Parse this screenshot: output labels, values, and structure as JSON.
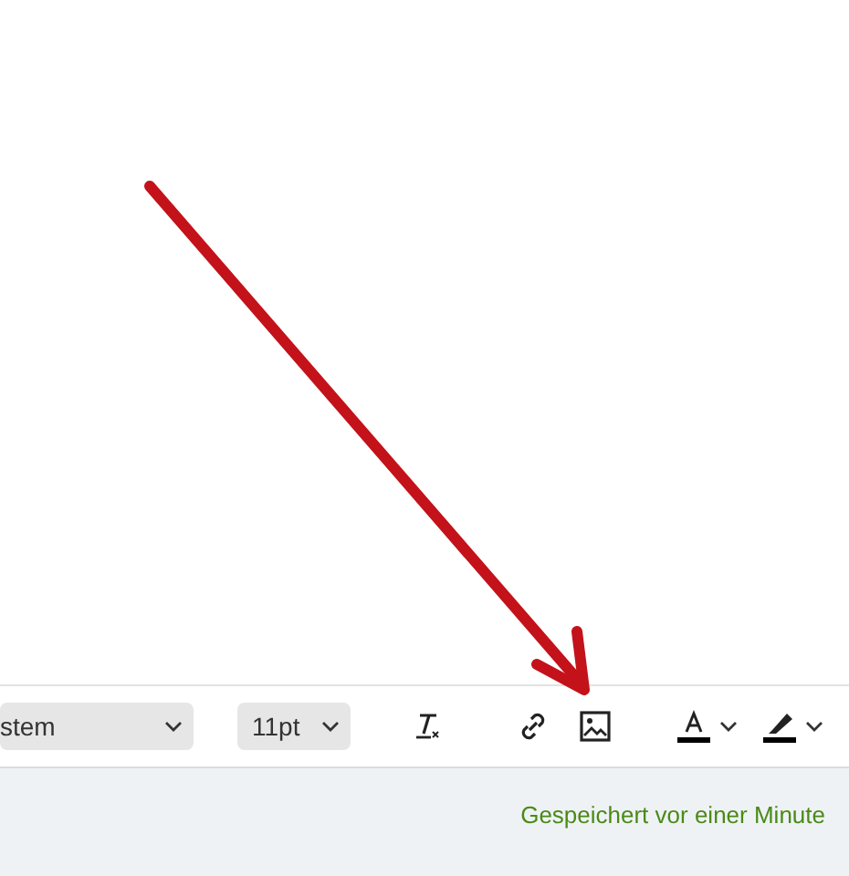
{
  "toolbar": {
    "font_select": {
      "value": "stem"
    },
    "size_select": {
      "value": "11pt"
    },
    "buttons": [
      {
        "kind": "clear-format"
      },
      {
        "kind": "link"
      },
      {
        "kind": "image"
      },
      {
        "kind": "text-color",
        "color": "#000000"
      },
      {
        "kind": "highlight",
        "color": "#000000"
      }
    ]
  },
  "status_bar": {
    "text": "Gespeichert vor einer Minute"
  }
}
